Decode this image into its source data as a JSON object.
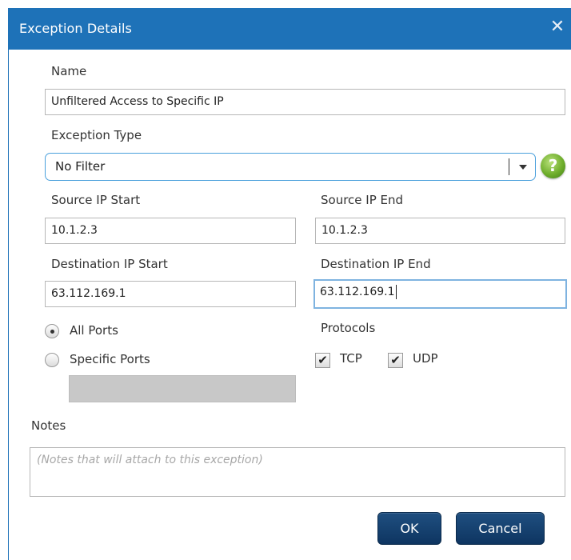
{
  "dialog": {
    "title": "Exception Details",
    "close_glyph": "✕"
  },
  "form": {
    "name_label": "Name",
    "name_value": "Unfiltered Access to Specific IP",
    "type_label": "Exception Type",
    "type_value": "No Filter",
    "help_glyph": "?",
    "source_start_label": "Source IP Start",
    "source_start_value": "10.1.2.3",
    "source_end_label": "Source IP End",
    "source_end_value": "10.1.2.3",
    "dest_start_label": "Destination IP Start",
    "dest_start_value": "63.112.169.1",
    "dest_end_label": "Destination IP End",
    "dest_end_value": "63.112.169.1",
    "ports_all_label": "All Ports",
    "ports_specific_label": "Specific Ports",
    "ports_selected": "All Ports",
    "protocols_label": "Protocols",
    "tcp_label": "TCP",
    "tcp_checked": true,
    "udp_label": "UDP",
    "udp_checked": true,
    "check_glyph": "✔",
    "notes_label": "Notes",
    "notes_placeholder": "(Notes that will attach to this exception)"
  },
  "buttons": {
    "ok_label": "OK",
    "cancel_label": "Cancel"
  },
  "colors": {
    "titlebar": "#1e72b8",
    "select_border": "#4aa0dc",
    "focus_border": "#7fb3e0",
    "button": "#123e6b",
    "help_green": "#6fae2c"
  },
  "icons": {
    "close": "close-icon",
    "help": "help-icon",
    "dropdown": "chevron-down-icon",
    "check": "checkmark-icon"
  }
}
